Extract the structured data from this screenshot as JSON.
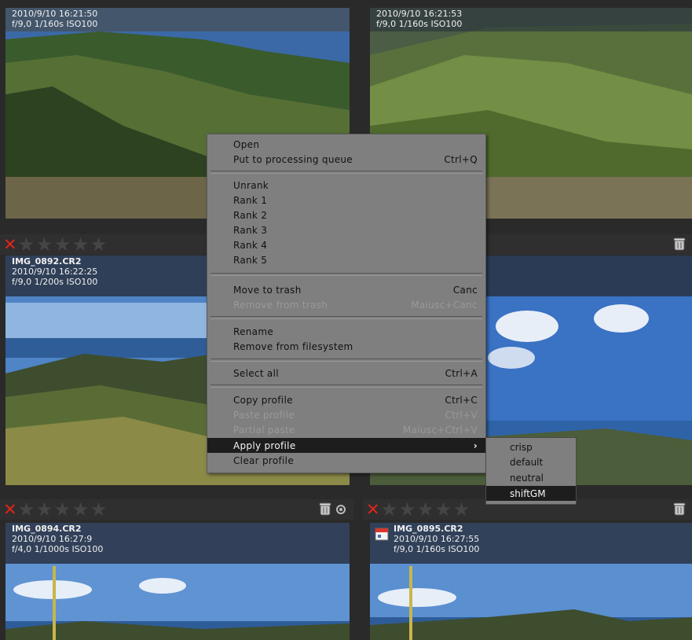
{
  "thumbs": [
    {
      "name": "",
      "date": "2010/9/10 16:21:50",
      "exif": "f/9,0 1/160s ISO100"
    },
    {
      "name": "",
      "date": "2010/9/10 16:21:53",
      "exif": "f/9,0 1/160s ISO100"
    },
    {
      "name": "IMG_0892.CR2",
      "date": "2010/9/10 16:22:25",
      "exif": "f/9,0 1/200s ISO100"
    },
    {
      "name": "",
      "date": "",
      "exif": ""
    },
    {
      "name": "IMG_0894.CR2",
      "date": "2010/9/10 16:27:9",
      "exif": "f/4,0 1/1000s ISO100"
    },
    {
      "name": "IMG_0895.CR2",
      "date": "2010/9/10 16:27:55",
      "exif": "f/9,0 1/160s ISO100"
    }
  ],
  "rank": {
    "unrank_mark": "✕",
    "star": "★"
  },
  "menu": {
    "items": [
      {
        "label": "Open",
        "shortcut": ""
      },
      {
        "label": "Put to processing queue",
        "shortcut": "Ctrl+Q"
      },
      {
        "label": "Unrank",
        "shortcut": ""
      },
      {
        "label": "Rank 1",
        "shortcut": ""
      },
      {
        "label": "Rank 2",
        "shortcut": ""
      },
      {
        "label": "Rank 3",
        "shortcut": ""
      },
      {
        "label": "Rank 4",
        "shortcut": ""
      },
      {
        "label": "Rank 5",
        "shortcut": ""
      },
      {
        "label": "Move to trash",
        "shortcut": "Canc"
      },
      {
        "label": "Remove from trash",
        "shortcut": "Maiusc+Canc"
      },
      {
        "label": "Rename",
        "shortcut": ""
      },
      {
        "label": "Remove from filesystem",
        "shortcut": ""
      },
      {
        "label": "Select all",
        "shortcut": "Ctrl+A"
      },
      {
        "label": "Copy profile",
        "shortcut": "Ctrl+C"
      },
      {
        "label": "Paste profile",
        "shortcut": "Ctrl+V"
      },
      {
        "label": "Partial paste",
        "shortcut": "Maiusc+Ctrl+V"
      },
      {
        "label": "Apply profile",
        "shortcut": "›"
      },
      {
        "label": "Clear profile",
        "shortcut": ""
      }
    ]
  },
  "submenu": {
    "items": [
      "crisp",
      "default",
      "neutral",
      "shiftGM"
    ]
  },
  "colors": {
    "menu_bg": "#7f7f7f",
    "highlight": "#1d1d1d",
    "unrank": "#e2241c"
  }
}
